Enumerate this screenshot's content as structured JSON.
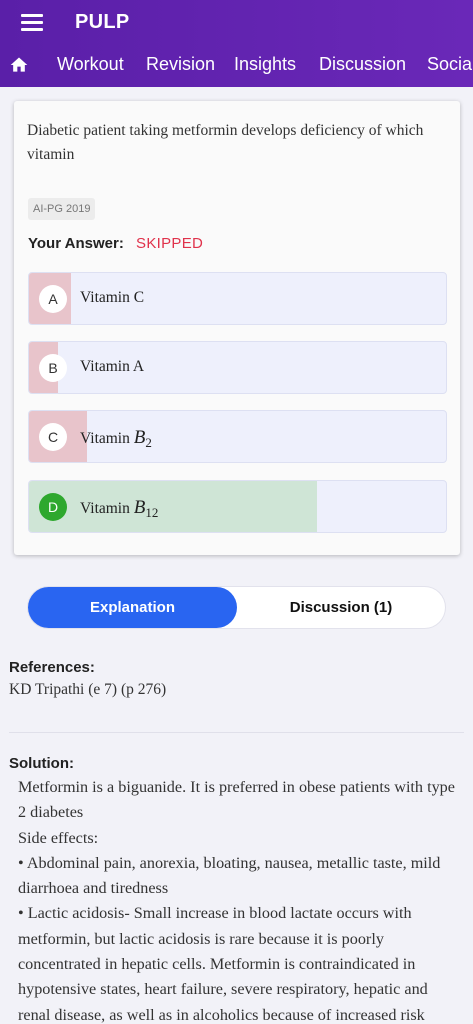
{
  "app": {
    "title": "PULP"
  },
  "icons": {
    "menu": "hamburger-menu-icon",
    "home": "home-icon"
  },
  "nav": {
    "tabs": [
      "Workout",
      "Revision",
      "Insights",
      "Discussion",
      "Social"
    ]
  },
  "question": {
    "text": "Diabetic patient taking metformin develops deficiency of which vitamin",
    "tag": "AI-PG 2019",
    "your_answer_label": "Your Answer:",
    "your_answer_value": "SKIPPED"
  },
  "options": [
    {
      "letter": "A",
      "text": "Vitamin C",
      "response_share": 0.1,
      "correct": false
    },
    {
      "letter": "B",
      "text": "Vitamin A",
      "response_share": 0.07,
      "correct": false
    },
    {
      "letter": "C",
      "text": "Vitamin ",
      "math": "B",
      "sub": "2",
      "response_share": 0.14,
      "correct": false
    },
    {
      "letter": "D",
      "text": "Vitamin ",
      "math": "B",
      "sub": "12",
      "response_share": 0.69,
      "correct": true
    }
  ],
  "colors": {
    "appbar": "#5a1fa8",
    "wrong_fill": "#e8c4cb",
    "correct_fill": "#cfe5d6",
    "correct_circle": "#2ea82e",
    "skipped": "#e0324b",
    "toggle_active": "#2965f1"
  },
  "tabs": {
    "explanation": "Explanation",
    "discussion": "Discussion (1)"
  },
  "references": {
    "heading": "References:",
    "text": "KD Tripathi (e 7) (p 276)"
  },
  "solution": {
    "heading": "Solution:",
    "lines": [
      "Metformin is a biguanide. It is preferred in obese patients with type 2 diabetes",
      "Side effects:",
      "•  Abdominal pain, anorexia, bloating, nausea, metallic taste, mild diarrhoea and tiredness",
      "•  Lactic acidosis- Small increase in blood lactate occurs with metformin, but lactic acidosis is rare because it is poorly concentrated in hepatic cells. Metformin is contraindicated in hypotensive states, heart failure, severe respiratory, hepatic and renal disease, as well as in alcoholics because of increased risk"
    ]
  }
}
